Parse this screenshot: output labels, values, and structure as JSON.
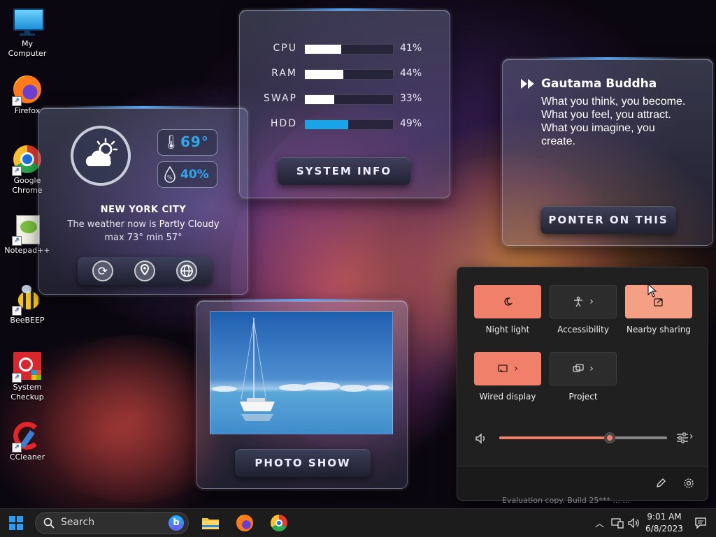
{
  "desktop_icons": [
    {
      "label": "My Computer",
      "icon": "monitor-icon"
    },
    {
      "label": "Firefox",
      "icon": "firefox-icon"
    },
    {
      "label": "Google Chrome",
      "icon": "chrome-icon"
    },
    {
      "label": "Notepad++",
      "icon": "notepad-plus-plus-icon"
    },
    {
      "label": "BeeBEEP",
      "icon": "bee-icon"
    },
    {
      "label": "System Checkup",
      "icon": "system-checkup-icon"
    },
    {
      "label": "CCleaner",
      "icon": "ccleaner-icon"
    }
  ],
  "weather": {
    "temperature": "69°",
    "humidity": "40%",
    "city": "NEW YORK CITY",
    "condition_prefix": "The weather now is ",
    "condition": "Partly Cloudy",
    "minmax": "max 73° min 57°",
    "buttons": [
      "refresh-icon",
      "location-pin-icon",
      "globe-icon"
    ]
  },
  "system_info": {
    "rows": [
      {
        "label": "CPU",
        "value": "41%",
        "fraction": 0.41,
        "color": "#ffffff"
      },
      {
        "label": "RAM",
        "value": "44%",
        "fraction": 0.44,
        "color": "#ffffff"
      },
      {
        "label": "SWAP",
        "value": "33%",
        "fraction": 0.33,
        "color": "#ffffff"
      },
      {
        "label": "HDD",
        "value": "49%",
        "fraction": 0.49,
        "color": "#1aa3e8"
      }
    ],
    "button_label": "SYSTEM INFO"
  },
  "quote": {
    "author": "Gautama Buddha",
    "text": "What you think, you become. What you feel, you attract. What you imagine, you create.",
    "button_label": "PONTER ON THIS"
  },
  "photo": {
    "button_label": "PHOTO SHOW"
  },
  "quick_settings": {
    "tiles": [
      {
        "label": "Night light",
        "icon": "night-light-icon",
        "state": "on",
        "chevron": false
      },
      {
        "label": "Accessibility",
        "icon": "accessibility-icon",
        "state": "off",
        "chevron": true
      },
      {
        "label": "Nearby sharing",
        "icon": "nearby-sharing-icon",
        "state": "light",
        "chevron": false
      },
      {
        "label": "Wired display",
        "icon": "wired-display-icon",
        "state": "on",
        "chevron": true
      },
      {
        "label": "Project",
        "icon": "project-icon",
        "state": "off",
        "chevron": true
      }
    ],
    "volume_fraction": 0.66,
    "accent": "#f0806a"
  },
  "watermark": "Evaluation copy. Build 25*** ... ...",
  "taskbar": {
    "search_placeholder": "Search",
    "time": "9:01 AM",
    "date": "6/8/2023"
  }
}
